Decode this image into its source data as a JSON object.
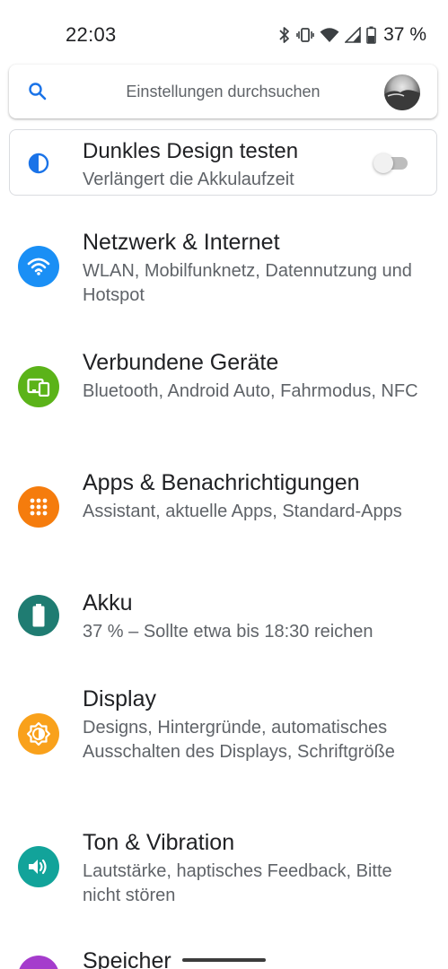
{
  "status_bar": {
    "time": "22:03",
    "battery_percent": "37 %",
    "icons": [
      "bluetooth-icon",
      "vibrate-icon",
      "wifi-icon",
      "cell-signal-icon",
      "battery-icon"
    ]
  },
  "search": {
    "placeholder": "Einstellungen durchsuchen",
    "icon": "search-icon",
    "accent_color": "#1a73e8"
  },
  "dark_theme_card": {
    "title": "Dunkles Design testen",
    "subtitle": "Verlängert die Akkulaufzeit",
    "toggle_on": false,
    "icon": "contrast-icon"
  },
  "settings_items": [
    {
      "title": "Netzwerk & Internet",
      "subtitle": "WLAN, Mobilfunknetz, Datennutzung und Hotspot",
      "icon": "wifi-icon",
      "color": "#1a8ff5"
    },
    {
      "title": "Verbundene Geräte",
      "subtitle": "Bluetooth, Android Auto, Fahrmodus, NFC",
      "icon": "devices-icon",
      "color": "#5bb319"
    },
    {
      "title": "Apps & Benachrichtigungen",
      "subtitle": "Assistant, aktuelle Apps, Standard-Apps",
      "icon": "apps-grid-icon",
      "color": "#f57c0d"
    },
    {
      "title": "Akku",
      "subtitle": "37 % – Sollte etwa bis 18:30 reichen",
      "icon": "battery-icon",
      "color": "#1f7c72"
    },
    {
      "title": "Display",
      "subtitle": "Designs, Hintergründe, automatisches Ausschalten des Displays, Schriftgröße",
      "icon": "brightness-icon",
      "color": "#f9a11b"
    },
    {
      "title": "Ton & Vibration",
      "subtitle": "Lautstärke, haptisches Feedback, Bitte nicht stören",
      "icon": "volume-icon",
      "color": "#12a39a"
    },
    {
      "title": "Speicher",
      "subtitle": "",
      "icon": "storage-icon",
      "color": "#a53ccc"
    }
  ]
}
